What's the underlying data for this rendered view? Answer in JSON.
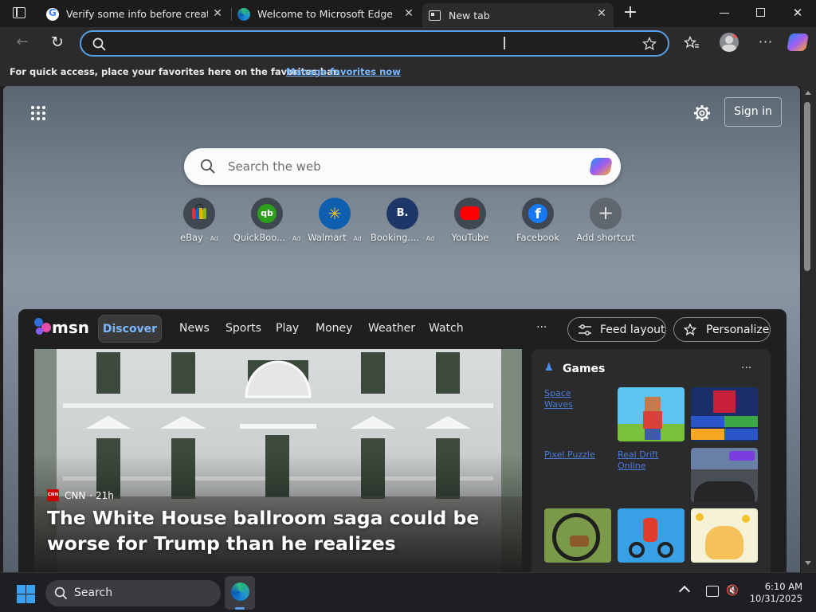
{
  "tabs": [
    {
      "title": "Verify some info before creating a..."
    },
    {
      "title": "Welcome to Microsoft Edge"
    },
    {
      "title": "New tab"
    }
  ],
  "favbar": {
    "message": "For quick access, place your favorites here on the favorites bar.",
    "link": "Manage favorites now"
  },
  "newtab": {
    "sign_in": "Sign in",
    "search_placeholder": "Search the web",
    "shortcuts": [
      {
        "label": "eBay",
        "ad": "· Ad",
        "icon": "ebay-bag-icon"
      },
      {
        "label": "QuickBoo...",
        "ad": "· Ad",
        "icon": "quickbooks-icon"
      },
      {
        "label": "Walmart",
        "ad": "· Ad",
        "icon": "walmart-spark-icon"
      },
      {
        "label": "Booking....",
        "ad": "· Ad",
        "icon": "booking-icon"
      },
      {
        "label": "YouTube",
        "ad": "",
        "icon": "youtube-icon"
      },
      {
        "label": "Facebook",
        "ad": "",
        "icon": "facebook-icon"
      },
      {
        "label": "Add shortcut",
        "ad": "",
        "icon": "plus-icon"
      }
    ]
  },
  "msn": {
    "brand": "msn",
    "nav": [
      "Discover",
      "News",
      "Sports",
      "Play",
      "Money",
      "Weather",
      "Watch"
    ],
    "more": "···",
    "feed_layout": "Feed layout",
    "personalize": "Personalize",
    "hero": {
      "source": "CNN",
      "source_logo": "CNN",
      "age": "· 21h",
      "headline": "The White House ballroom saga could be worse for Trump than he realizes"
    },
    "games": {
      "title": "Games",
      "more": "···",
      "broken": [
        "Space Waves",
        "Pixel Puzzle",
        "Real Drift Online"
      ]
    }
  },
  "taskbar": {
    "search": "Search",
    "time": "6:10 AM",
    "date": "10/31/2025"
  },
  "colors": {
    "accent": "#5aa0e6",
    "link": "#7ab7ff"
  }
}
